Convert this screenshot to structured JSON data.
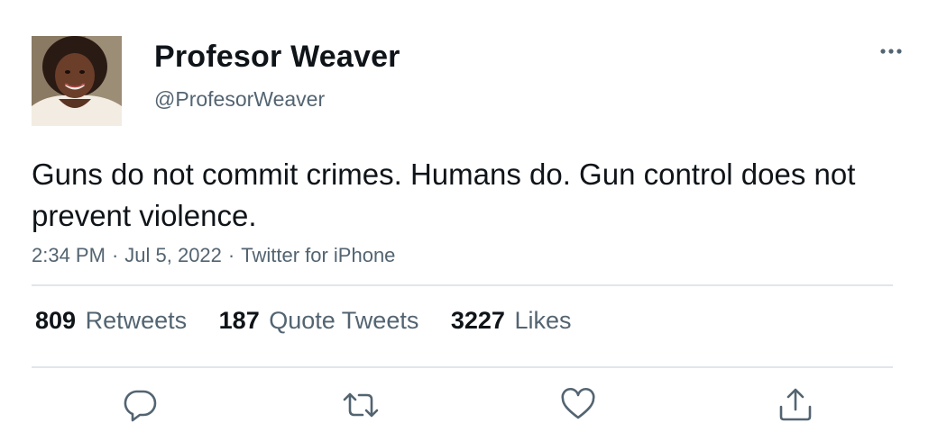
{
  "tweet": {
    "display_name": "Profesor Weaver",
    "handle": "@ProfesorWeaver",
    "text": "Guns do not commit crimes. Humans do. Gun control does not prevent violence.",
    "time": "2:34 PM",
    "date": "Jul 5, 2022",
    "source": "Twitter for iPhone",
    "separator": "·"
  },
  "stats": {
    "retweets_count": "809",
    "retweets_label": "Retweets",
    "quotes_count": "187",
    "quotes_label": "Quote Tweets",
    "likes_count": "3227",
    "likes_label": "Likes"
  },
  "icons": {
    "more": "more-icon",
    "reply": "reply-icon",
    "retweet": "retweet-icon",
    "like": "like-icon",
    "share": "share-icon"
  },
  "colors": {
    "text": "#0f1419",
    "secondary": "#536471",
    "divider": "#e1e6ea"
  }
}
